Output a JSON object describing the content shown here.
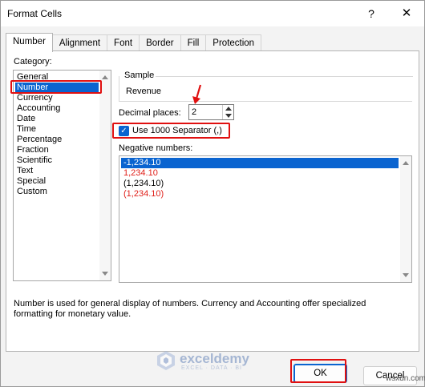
{
  "window": {
    "title": "Format Cells",
    "help_label": "?",
    "close_label": "✕"
  },
  "tabs": [
    {
      "label": "Number",
      "active": true
    },
    {
      "label": "Alignment",
      "active": false
    },
    {
      "label": "Font",
      "active": false
    },
    {
      "label": "Border",
      "active": false
    },
    {
      "label": "Fill",
      "active": false
    },
    {
      "label": "Protection",
      "active": false
    }
  ],
  "category": {
    "label": "Category:",
    "items": [
      "General",
      "Number",
      "Currency",
      "Accounting",
      "Date",
      "Time",
      "Percentage",
      "Fraction",
      "Scientific",
      "Text",
      "Special",
      "Custom"
    ],
    "selected": "Number"
  },
  "sample": {
    "legend": "Sample",
    "value": "Revenue"
  },
  "decimal_places": {
    "label": "Decimal places:",
    "value": "2"
  },
  "separator": {
    "label": "Use 1000 Separator (,)",
    "checked": true,
    "check_glyph": "✓"
  },
  "negative_numbers": {
    "label": "Negative numbers:",
    "items": [
      {
        "text": "-1,234.10",
        "color": "#000000",
        "selected": true
      },
      {
        "text": "1,234.10",
        "color": "#e0201a",
        "selected": false
      },
      {
        "text": "(1,234.10)",
        "color": "#000000",
        "selected": false
      },
      {
        "text": "(1,234.10)",
        "color": "#e0201a",
        "selected": false
      }
    ]
  },
  "description": "Number is used for general display of numbers.  Currency and Accounting offer specialized formatting for monetary value.",
  "watermark": {
    "name": "exceldemy",
    "tagline": "EXCEL · DATA · BI"
  },
  "buttons": {
    "ok": "OK",
    "cancel": "Cancel"
  },
  "corner_watermark": "wsxdn.com",
  "colors": {
    "accent": "#0a64d0",
    "highlight": "#e01010",
    "negative_red": "#e0201a"
  }
}
